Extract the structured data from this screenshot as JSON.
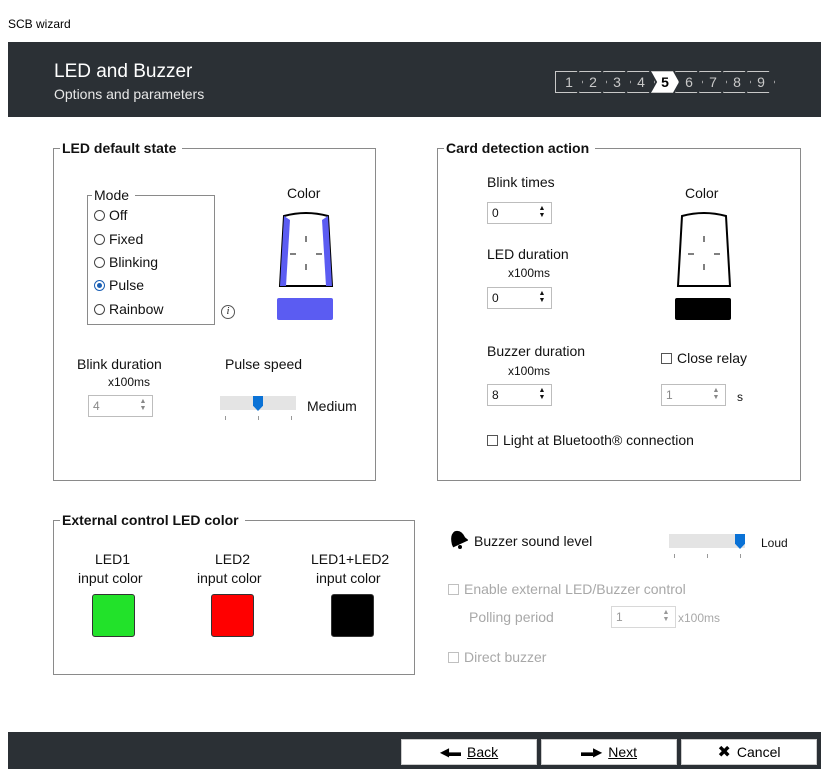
{
  "window": {
    "title": "SCB wizard"
  },
  "header": {
    "title": "LED and Buzzer",
    "subtitle": "Options and parameters",
    "steps": [
      "1",
      "2",
      "3",
      "4",
      "5",
      "6",
      "7",
      "8",
      "9"
    ],
    "active_step": "5"
  },
  "led_default": {
    "legend": "LED default state",
    "mode_legend": "Mode",
    "modes": [
      "Off",
      "Fixed",
      "Blinking",
      "Pulse",
      "Rainbow"
    ],
    "selected_mode": "Pulse",
    "color_label": "Color",
    "color_value": "#5b5cf2",
    "info_icon": "i",
    "blink_duration_label": "Blink duration",
    "blink_unit": "x100ms",
    "blink_value": "4",
    "pulse_speed_label": "Pulse speed",
    "pulse_speed_value": "Medium",
    "pulse_speed_fraction": 0.5
  },
  "card_detection": {
    "legend": "Card detection action",
    "blink_times_label": "Blink times",
    "blink_times_value": "0",
    "led_duration_label": "LED duration",
    "led_duration_unit": "x100ms",
    "led_duration_value": "0",
    "color_label": "Color",
    "color_value": "#000000",
    "buzzer_duration_label": "Buzzer duration",
    "buzzer_duration_unit": "x100ms",
    "buzzer_duration_value": "8",
    "close_relay_label": "Close relay",
    "relay_value": "1",
    "relay_unit": "s",
    "bluetooth_label": "Light at Bluetooth® connection"
  },
  "external_led": {
    "legend": "External control LED color",
    "items": [
      {
        "line1": "LED1",
        "line2": "input color",
        "color": "#22e22a"
      },
      {
        "line1": "LED2",
        "line2": "input color",
        "color": "#ff0000"
      },
      {
        "line1": "LED1+LED2",
        "line2": "input color",
        "color": "#000000"
      }
    ]
  },
  "buzzer": {
    "label": "Buzzer sound level",
    "level_label": "Loud",
    "level_fraction": 1.0,
    "enable_external_label": "Enable external LED/Buzzer control",
    "polling_label": "Polling period",
    "polling_value": "1",
    "polling_unit": "x100ms",
    "direct_buzzer_label": "Direct buzzer"
  },
  "footer": {
    "back_label": "Back",
    "next_label": "Next",
    "cancel_label": "Cancel"
  }
}
